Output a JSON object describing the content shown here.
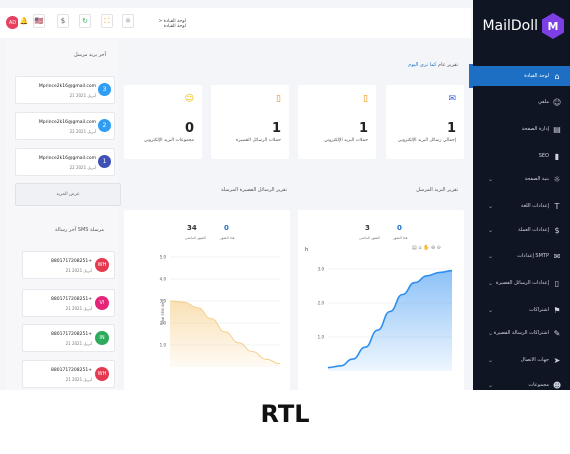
{
  "app": {
    "name": "MailDoll"
  },
  "topbar": {
    "avatar": "AD",
    "breadcrumb": "لوحة القيادة < لوحة القيادة"
  },
  "sidebar": {
    "items": [
      {
        "label": "لوحة القيادة",
        "icon": "home-icon",
        "active": true
      },
      {
        "label": "ملفي",
        "icon": "user-icon"
      },
      {
        "label": "إدارة الصفحة",
        "icon": "file-icon"
      },
      {
        "label": "SEO",
        "icon": "chart-icon"
      },
      {
        "label": "بنية الصفحة",
        "icon": "sun-icon",
        "chevron": true
      },
      {
        "label": "إعدادات اللغة",
        "icon": "text-icon",
        "chevron": true
      },
      {
        "label": "إعدادات العملة",
        "icon": "dollar-icon",
        "chevron": true
      },
      {
        "label": "إعدادات SMTP",
        "icon": "mail-icon",
        "chevron": true
      },
      {
        "label": "إعدادات الرسائل القصيرة",
        "icon": "phone-icon",
        "chevron": true
      },
      {
        "label": "اشتراكات",
        "icon": "gift-icon",
        "chevron": true
      },
      {
        "label": "اشتراكات الرسالة القصيرة",
        "icon": "sms-icon",
        "chevron": true
      },
      {
        "label": "جهات الاتصال",
        "icon": "send-icon",
        "chevron": true
      },
      {
        "label": "مجموعات",
        "icon": "group-icon",
        "chevron": true
      }
    ]
  },
  "overview": {
    "title": "تقرير عام",
    "subtitle": "كما ترى اليوم"
  },
  "stats": [
    {
      "value": "1",
      "label": "إجمالي رسائل البريد الإلكتروني",
      "icon": "envelope-icon",
      "color": "#3b5bdb"
    },
    {
      "value": "1",
      "label": "حملات البريد الإلكتروني",
      "icon": "book-icon",
      "color": "#f08c00"
    },
    {
      "value": "1",
      "label": "حملات الرسائل القصيرة",
      "icon": "book-icon",
      "color": "#f08c00"
    },
    {
      "value": "0",
      "label": "مجموعات البريد الإلكتروني",
      "icon": "users-icon",
      "color": "#f0b400"
    }
  ],
  "email_report": {
    "title": "تقرير البريد المرسل",
    "this_month": {
      "value": "0",
      "label": "هذا الشهر"
    },
    "last_month": {
      "value": "3",
      "label": "الشهر الماضي"
    },
    "chart_letter": "h"
  },
  "sms_report": {
    "title": "تقرير الرسائل القصيرة المرسلة",
    "this_month": {
      "value": "0",
      "label": "هذا الشهر"
    },
    "last_month": {
      "value": "34",
      "label": "الشهر الماضي"
    },
    "ylabel": "Total SMS Sent"
  },
  "chart_data": [
    {
      "type": "area",
      "title": "",
      "x": [
        0,
        1,
        2,
        3,
        4,
        5,
        6,
        7,
        8,
        9,
        10
      ],
      "y": [
        0.1,
        0.15,
        0.35,
        0.7,
        1.2,
        1.75,
        2.25,
        2.6,
        2.8,
        2.9,
        2.95
      ],
      "ylim": [
        0,
        3.0
      ],
      "yticks": [
        "3.0",
        "2.0",
        "1.0"
      ],
      "color": "#2f8ff0",
      "grid": true
    },
    {
      "type": "area",
      "title": "",
      "ylabel": "Total SMS Sent",
      "x": [
        0,
        1,
        2,
        3,
        4,
        5,
        6,
        7,
        8
      ],
      "y": [
        3.0,
        2.95,
        2.7,
        2.2,
        1.6,
        1.1,
        0.7,
        0.35,
        0.15
      ],
      "ylim": [
        0,
        5.0
      ],
      "yticks": [
        "5.0",
        "4.0",
        "3.0",
        "2.0",
        "1.0"
      ],
      "color": "#f5c87a",
      "grid": true
    }
  ],
  "recent_mail": {
    "title": "آخر بريد مرسل",
    "items": [
      {
        "email": "Mprince2k16@gmail.com",
        "date": "21 أبريل 2021",
        "num": "3",
        "color": "#2f9df4"
      },
      {
        "email": "Mprince2k16@gmail.com",
        "date": "22 أبريل 2021",
        "num": "2",
        "color": "#2f9df4"
      },
      {
        "email": "Mprince2k16@gmail.com",
        "date": "22 أبريل 2021",
        "num": "1",
        "color": "#3f51b5"
      }
    ],
    "button": "عرض المزيد"
  },
  "recent_sms": {
    "title": "آخر رسالة SMS مرسلة",
    "items": [
      {
        "phone": "8801717208251+",
        "date": "21 أبريل 2021",
        "initials": "WH",
        "color": "#e53950"
      },
      {
        "phone": "8801717208251+",
        "date": "21 أبريل 2021",
        "initials": "VI",
        "color": "#e5257a"
      },
      {
        "phone": "8801717208251+",
        "date": "21 أبريل 2021",
        "initials": "IN",
        "color": "#2eaa5c"
      },
      {
        "phone": "8801717208251+",
        "date": "21 أبريل 2021",
        "initials": "WH",
        "color": "#e53950"
      }
    ]
  },
  "caption": "RTL"
}
